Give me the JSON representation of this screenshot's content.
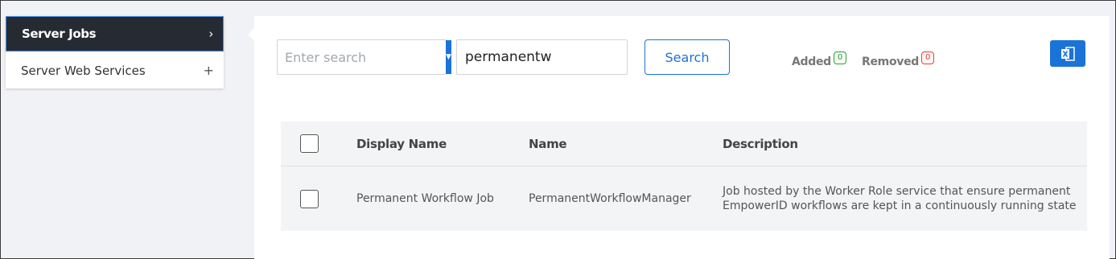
{
  "sidebar": {
    "items": [
      {
        "label": "Server Jobs",
        "icon": "chevron-right-icon",
        "glyph": "›",
        "active": true
      },
      {
        "label": "Server Web Services",
        "icon": "plus-icon",
        "glyph": "+",
        "active": false
      }
    ]
  },
  "toolbar": {
    "search_placeholder": "Enter search",
    "dropdown_glyph": "▼",
    "query_value": "permanentw",
    "search_label": "Search",
    "added_label": "Added",
    "added_count": "0",
    "removed_label": "Removed",
    "removed_count": "0",
    "export_icon": "excel-export-icon"
  },
  "table": {
    "columns": [
      "Display Name",
      "Name",
      "Description"
    ],
    "rows": [
      {
        "display_name": "Permanent Workflow Job",
        "name": "PermanentWorkflowManager",
        "description": "Job hosted by the Worker Role service that ensure permanent EmpowerID workflows are kept in a continuously running state"
      }
    ]
  },
  "colors": {
    "accent": "#1a73d9",
    "sidebar_active_bg": "#262a33",
    "added": "#2e9d3a",
    "removed": "#e0463a",
    "page_bg": "#f1f2f6"
  }
}
